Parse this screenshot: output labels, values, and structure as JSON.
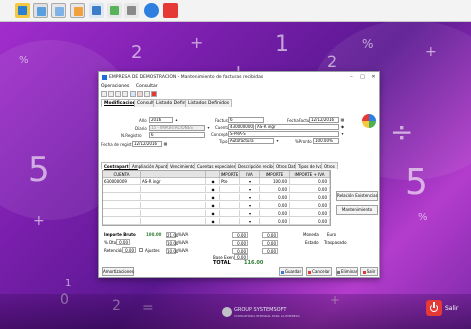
{
  "window": {
    "title": "EMPRESA DE DEMOSTRACION - Mantenimiento de facturas recibidas",
    "controls": [
      "–",
      "□",
      "✕"
    ]
  },
  "menu": [
    "Operaciones",
    "Consultar"
  ],
  "tabs_top": [
    "Modificaciones",
    "Consulta",
    "Listado Definido",
    "Listados Definidos"
  ],
  "header": {
    "anio_label": "Año",
    "anio_value": "2016",
    "diario_label": "Diario",
    "diario_value": "15 - IMPORTACIONES",
    "n_registro_label": "N.Registro",
    "n_registro_value": "6",
    "fecha_registro_label": "Fecha de registro",
    "fecha_registro_value": "12/12/2016",
    "factura_label": "Factura",
    "factura_value": "6",
    "fecha_factura_label": "FechaFactura",
    "fecha_factura_value": "12/12/2016",
    "cuenta_label": "Cuenta",
    "cuenta_value": "430000000",
    "cuenta_name": "AS-R ingr",
    "concepto_label": "Concepto",
    "concepto_value": "S-PRA-S",
    "tipo_label": "Tipo",
    "tipo_value": "Autofactura",
    "pronto_label": "%Pronto",
    "pronto_value": "100.00%"
  },
  "tabs_lines": [
    "Contrapartidas",
    "Ampliación Apuntes",
    "Vencimientos",
    "Cuentas especiales",
    "Descripción recibo",
    "Otros Datos",
    "Tipos de Iva",
    "Otros"
  ],
  "grid": {
    "headers": [
      "CUENTA",
      "",
      "",
      "IMPORTE",
      "IVA",
      "IMPORTE",
      "IMPORTE + IVA"
    ],
    "rows": [
      {
        "cuenta": "630000009",
        "desc": "AS-R ingr",
        "iva": "Pte",
        "importe": "100.00",
        "importe_iva": "0.00"
      },
      {
        "cuenta": "",
        "desc": "",
        "iva": "",
        "importe": "0.00",
        "importe_iva": "0.00"
      },
      {
        "cuenta": "",
        "desc": "",
        "iva": "",
        "importe": "0.00",
        "importe_iva": "0.00"
      },
      {
        "cuenta": "",
        "desc": "",
        "iva": "",
        "importe": "0.00",
        "importe_iva": "0.00"
      },
      {
        "cuenta": "",
        "desc": "",
        "iva": "",
        "importe": "0.00",
        "importe_iva": "0.00"
      },
      {
        "cuenta": "",
        "desc": "",
        "iva": "",
        "importe": "0.00",
        "importe_iva": "0.00"
      }
    ]
  },
  "side_buttons": [
    "Relación Existencias",
    "Mantenimiento"
  ],
  "totals": {
    "importe_bruto_label": "Importe Bruto",
    "importe_bruto_value": "100.00",
    "dto_label": "% Dto",
    "dto_value": "0.00",
    "retencion_label": "Retención",
    "retencion_value": "0.00",
    "ajustes_label": "Ajustes",
    "base_exenta_label": "Base Exenta",
    "base_exenta_value": "0.00",
    "total_label": "TOTAL",
    "total_value": "116.00",
    "moneda_label": "Moneda",
    "moneda_value": "Euro",
    "estado_label": "Estado",
    "estado_value": "Traspasado",
    "iva_rows": [
      {
        "base": "21.00",
        "label": "%IVA",
        "cuota": "0.00",
        "extra": "0.00"
      },
      {
        "base": "10.00",
        "label": "%IVA",
        "cuota": "0.00",
        "extra": "0.00"
      },
      {
        "base": "10.00",
        "label": "%IVA",
        "cuota": "0.00",
        "extra": "0.00"
      }
    ]
  },
  "footer": {
    "amortizaciones": "Amortizaciones",
    "guardar": "Guardar",
    "cancelar": "Cancelar",
    "eliminar": "Eliminar",
    "salir": "Salir"
  },
  "desktop": {
    "salir_label": "Salir",
    "brand_text": "GROUP SYSTEMSOFT",
    "brand_tagline": "CONSULTORIA INTEGRAL PARA LA EMPRESA"
  },
  "colors": {
    "desktop_bg": "#7b1fae",
    "accent_red": "#e53935",
    "titlebar_blue": "#1e6fd9"
  }
}
